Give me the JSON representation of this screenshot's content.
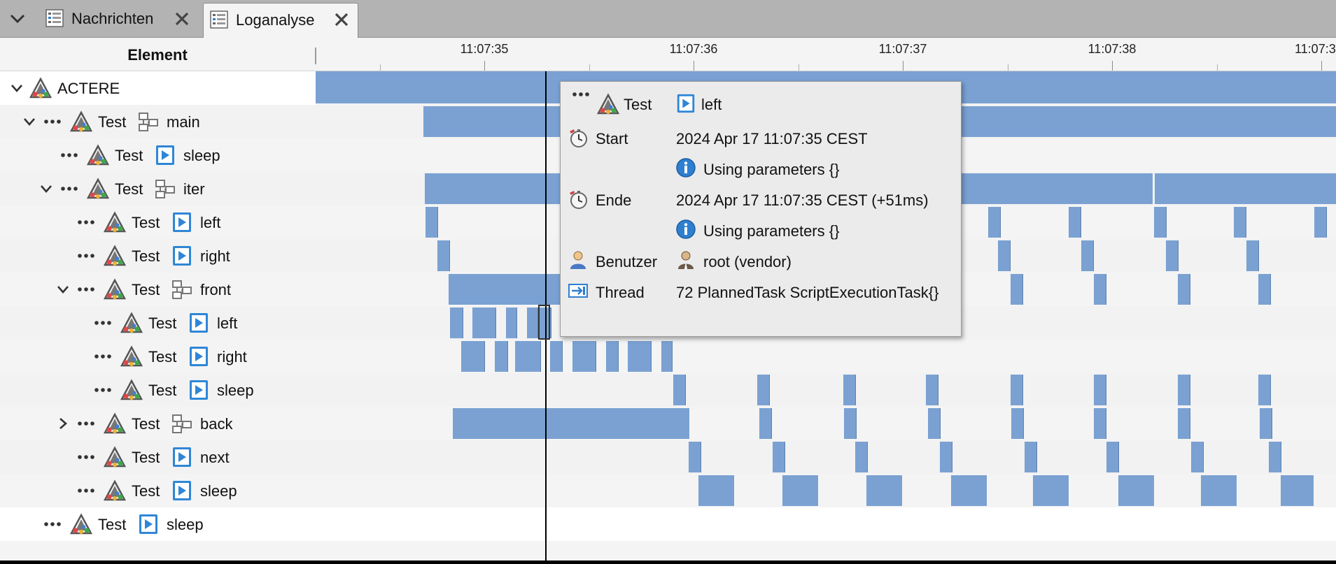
{
  "tabs": [
    {
      "label": "Nachrichten",
      "active": false
    },
    {
      "label": "Loganalyse",
      "active": true
    }
  ],
  "tree_header": "Element",
  "timeline": {
    "ticks": [
      "11:07:35",
      "11:07:36",
      "11:07:37",
      "11:07:38",
      "11:07:3"
    ]
  },
  "tree": {
    "root_label": "ACTERE",
    "rows": [
      {
        "type": "Test",
        "name": "main"
      },
      {
        "type": "Test",
        "name": "sleep"
      },
      {
        "type": "Test",
        "name": "iter"
      },
      {
        "type": "Test",
        "name": "left"
      },
      {
        "type": "Test",
        "name": "right"
      },
      {
        "type": "Test",
        "name": "front"
      },
      {
        "type": "Test",
        "name": "left"
      },
      {
        "type": "Test",
        "name": "right"
      },
      {
        "type": "Test",
        "name": "sleep"
      },
      {
        "type": "Test",
        "name": "back"
      },
      {
        "type": "Test",
        "name": "next"
      },
      {
        "type": "Test",
        "name": "sleep"
      },
      {
        "type": "Test",
        "name": "sleep"
      }
    ]
  },
  "tooltip": {
    "title_type": "Test",
    "title_name": "left",
    "start_label": "Start",
    "start_value": "2024 Apr 17 11:07:35 CEST",
    "start_info": "Using parameters {}",
    "end_label": "Ende",
    "end_value": "2024 Apr 17 11:07:35 CEST (+51ms)",
    "end_info": "Using parameters {}",
    "user_label": "Benutzer",
    "user_value": "root (vendor)",
    "thread_label": "Thread",
    "thread_value": "72 PlannedTask ScriptExecutionTask{}"
  },
  "colors": {
    "bar": "#7aa1d2",
    "action_icon": "#2f86d6",
    "info_icon": "#2f7fd0"
  },
  "icons": {
    "tab": "table-log-icon",
    "close": "close-icon",
    "test": "actere-triangle-icon",
    "action": "play-action-icon",
    "group": "group-nodes-icon",
    "info": "info-icon",
    "start": "stopwatch-icon",
    "user": "user-icon",
    "thread": "thread-icon"
  }
}
